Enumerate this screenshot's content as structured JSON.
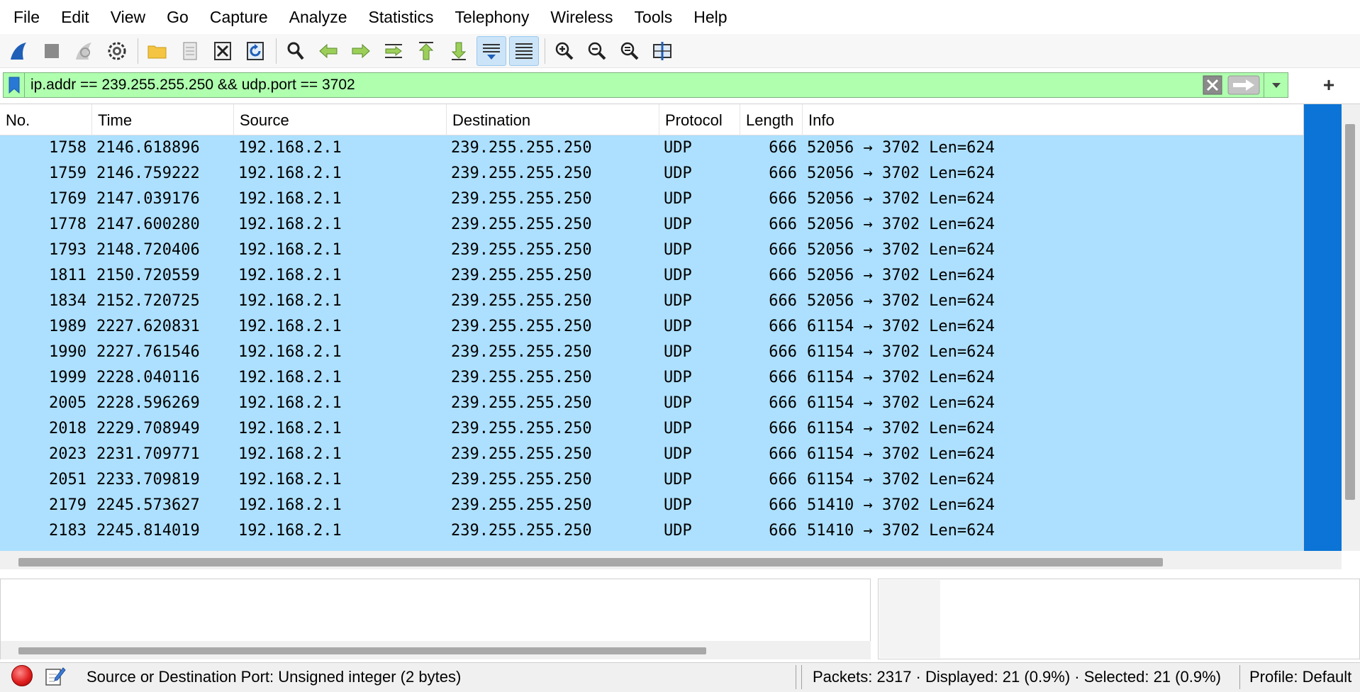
{
  "menu": [
    "File",
    "Edit",
    "View",
    "Go",
    "Capture",
    "Analyze",
    "Statistics",
    "Telephony",
    "Wireless",
    "Tools",
    "Help"
  ],
  "toolbar": {
    "icons": [
      "shark-fin-start-icon",
      "stop-square-icon",
      "restart-fin-icon",
      "capture-options-gear-icon",
      "open-folder-icon",
      "recent-files-icon",
      "close-file-icon",
      "reload-icon",
      "find-packet-icon",
      "go-back-arrow-icon",
      "go-forward-arrow-icon",
      "go-to-packet-icon",
      "first-packet-icon",
      "last-packet-icon",
      "autoscroll-icon",
      "colorize-icon",
      "zoom-in-icon",
      "zoom-out-icon",
      "zoom-normal-icon",
      "resize-columns-icon"
    ]
  },
  "filter": {
    "value": "ip.addr == 239.255.255.250 && udp.port == 3702",
    "add_label": "+"
  },
  "columns": [
    "No.",
    "Time",
    "Source",
    "Destination",
    "Protocol",
    "Length",
    "Info"
  ],
  "packets": [
    {
      "no": "1758",
      "time": "2146.618896",
      "src": "192.168.2.1",
      "dst": "239.255.255.250",
      "proto": "UDP",
      "len": "666",
      "info": "52056 → 3702 Len=624"
    },
    {
      "no": "1759",
      "time": "2146.759222",
      "src": "192.168.2.1",
      "dst": "239.255.255.250",
      "proto": "UDP",
      "len": "666",
      "info": "52056 → 3702 Len=624"
    },
    {
      "no": "1769",
      "time": "2147.039176",
      "src": "192.168.2.1",
      "dst": "239.255.255.250",
      "proto": "UDP",
      "len": "666",
      "info": "52056 → 3702 Len=624"
    },
    {
      "no": "1778",
      "time": "2147.600280",
      "src": "192.168.2.1",
      "dst": "239.255.255.250",
      "proto": "UDP",
      "len": "666",
      "info": "52056 → 3702 Len=624"
    },
    {
      "no": "1793",
      "time": "2148.720406",
      "src": "192.168.2.1",
      "dst": "239.255.255.250",
      "proto": "UDP",
      "len": "666",
      "info": "52056 → 3702 Len=624"
    },
    {
      "no": "1811",
      "time": "2150.720559",
      "src": "192.168.2.1",
      "dst": "239.255.255.250",
      "proto": "UDP",
      "len": "666",
      "info": "52056 → 3702 Len=624"
    },
    {
      "no": "1834",
      "time": "2152.720725",
      "src": "192.168.2.1",
      "dst": "239.255.255.250",
      "proto": "UDP",
      "len": "666",
      "info": "52056 → 3702 Len=624"
    },
    {
      "no": "1989",
      "time": "2227.620831",
      "src": "192.168.2.1",
      "dst": "239.255.255.250",
      "proto": "UDP",
      "len": "666",
      "info": "61154 → 3702 Len=624"
    },
    {
      "no": "1990",
      "time": "2227.761546",
      "src": "192.168.2.1",
      "dst": "239.255.255.250",
      "proto": "UDP",
      "len": "666",
      "info": "61154 → 3702 Len=624"
    },
    {
      "no": "1999",
      "time": "2228.040116",
      "src": "192.168.2.1",
      "dst": "239.255.255.250",
      "proto": "UDP",
      "len": "666",
      "info": "61154 → 3702 Len=624"
    },
    {
      "no": "2005",
      "time": "2228.596269",
      "src": "192.168.2.1",
      "dst": "239.255.255.250",
      "proto": "UDP",
      "len": "666",
      "info": "61154 → 3702 Len=624"
    },
    {
      "no": "2018",
      "time": "2229.708949",
      "src": "192.168.2.1",
      "dst": "239.255.255.250",
      "proto": "UDP",
      "len": "666",
      "info": "61154 → 3702 Len=624"
    },
    {
      "no": "2023",
      "time": "2231.709771",
      "src": "192.168.2.1",
      "dst": "239.255.255.250",
      "proto": "UDP",
      "len": "666",
      "info": "61154 → 3702 Len=624"
    },
    {
      "no": "2051",
      "time": "2233.709819",
      "src": "192.168.2.1",
      "dst": "239.255.255.250",
      "proto": "UDP",
      "len": "666",
      "info": "61154 → 3702 Len=624"
    },
    {
      "no": "2179",
      "time": "2245.573627",
      "src": "192.168.2.1",
      "dst": "239.255.255.250",
      "proto": "UDP",
      "len": "666",
      "info": "51410 → 3702 Len=624"
    },
    {
      "no": "2183",
      "time": "2245.814019",
      "src": "192.168.2.1",
      "dst": "239.255.255.250",
      "proto": "UDP",
      "len": "666",
      "info": "51410 → 3702 Len=624"
    }
  ],
  "colors": {
    "row_bg": "#ade0ff",
    "filter_bg": "#afffaf",
    "minimap": "#0b74d6"
  },
  "status": {
    "field_info": "Source or Destination Port: Unsigned integer (2 bytes)",
    "packets": "Packets: 2317 · Displayed: 21 (0.9%) · Selected: 21 (0.9%)",
    "profile": "Profile: Default"
  }
}
